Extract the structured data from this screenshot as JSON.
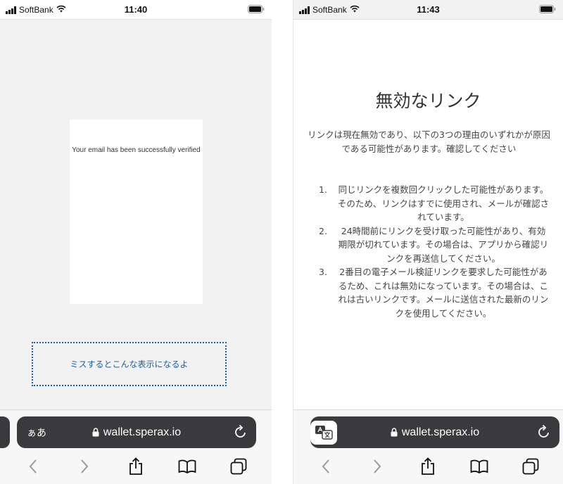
{
  "left_phone": {
    "status": {
      "carrier": "SoftBank",
      "time": "11:40"
    },
    "card_message": "Your email has been successfully verified",
    "note": "ミスするとこんな表示になるよ",
    "url_bar": {
      "aa_label": "ぁあ",
      "url": "wallet.sperax.io"
    }
  },
  "right_phone": {
    "status": {
      "carrier": "SoftBank",
      "time": "11:43"
    },
    "heading": "無効なリンク",
    "intro": "リンクは現在無効であり、以下の3つの理由のいずれかが原因である可能性があります。確認してください",
    "reasons": [
      {
        "num": "1.",
        "text": "同じリンクを複数回クリックした可能性があります。そのため、リンクはすでに使用され、メールが確認されています。"
      },
      {
        "num": "2.",
        "text": "24時間前にリンクを受け取った可能性があり、有効期限が切れています。その場合は、アプリから確認リンクを再送信してください。"
      },
      {
        "num": "3.",
        "text": "2番目の電子メール検証リンクを要求した可能性があるため、これは無効になっています。その場合は、これは古いリンクです。メールに送信された最新のリンクを使用してください。"
      }
    ],
    "url_bar": {
      "url": "wallet.sperax.io"
    }
  },
  "colors": {
    "accent_blue": "#1a5fa8",
    "url_bar": "#3a3a3c",
    "icon_blue": "#007aff"
  },
  "icons": [
    "signal-icon",
    "wifi-icon",
    "battery-icon",
    "lock-icon",
    "reload-icon",
    "translate-icon",
    "back-icon",
    "forward-icon",
    "share-icon",
    "bookmarks-icon",
    "tabs-icon"
  ]
}
